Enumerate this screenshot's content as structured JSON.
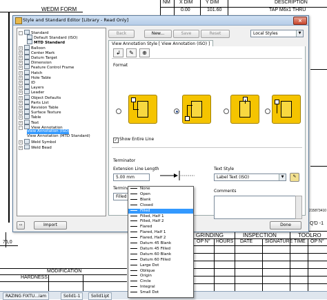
{
  "window": {
    "title": "Style and Standard Editor [Library - Read Only]",
    "close_glyph": "×"
  },
  "background": {
    "form_title": "WEDM FORM",
    "table_headers": [
      "NM",
      "X DIM",
      "Y DIM"
    ],
    "table_values": [
      "0.00",
      "101.60"
    ],
    "description_label": "DESCRIPTION",
    "tap_label": "TAP M6x1 THRU",
    "dim_75": "75,0",
    "part_no": "215873410",
    "qty_label": "Q'D -1",
    "grinding_label": "GRINDING",
    "inspection_label": "INSPECTION",
    "toolroom_label": "TOOLRO",
    "op_no": "OP N°",
    "hours": "HOURS",
    "date1": "DATE",
    "signature": "SIGNATURE",
    "time": "TIME",
    "op_no2": "OP N°",
    "modification": "MODIFICATION",
    "hardness": "HARDNESS",
    "tabs": [
      "RAZING FIXTU...iam",
      "Solid1-1",
      "Solid1ipt"
    ]
  },
  "toolbar": {
    "back": "Back",
    "new": "New...",
    "save": "Save",
    "reset": "Reset",
    "filter": "Local Styles"
  },
  "tree": [
    {
      "label": "Standard",
      "indent": 0,
      "bold": false,
      "expander": "-",
      "icon": "folder-icon"
    },
    {
      "label": "Default Standard (ISO)",
      "indent": 1,
      "bold": false,
      "expander": "",
      "icon": "standard-icon"
    },
    {
      "label": "MTD Standard",
      "indent": 1,
      "bold": true,
      "expander": "",
      "icon": "standard-icon"
    },
    {
      "label": "Balloon",
      "indent": 0,
      "bold": false,
      "expander": "+",
      "icon": "balloon-icon"
    },
    {
      "label": "Center Mark",
      "indent": 0,
      "bold": false,
      "expander": "+",
      "icon": "center-mark-icon"
    },
    {
      "label": "Datum Target",
      "indent": 0,
      "bold": false,
      "expander": "+",
      "icon": "datum-target-icon"
    },
    {
      "label": "Dimension",
      "indent": 0,
      "bold": false,
      "expander": "+",
      "icon": "dimension-icon"
    },
    {
      "label": "Feature Control Frame",
      "indent": 0,
      "bold": false,
      "expander": "+",
      "icon": "fcf-icon"
    },
    {
      "label": "Hatch",
      "indent": 0,
      "bold": false,
      "expander": "+",
      "icon": "hatch-icon"
    },
    {
      "label": "Hole Table",
      "indent": 0,
      "bold": false,
      "expander": "+",
      "icon": "hole-table-icon"
    },
    {
      "label": "ID",
      "indent": 0,
      "bold": false,
      "expander": "+",
      "icon": "id-icon"
    },
    {
      "label": "Layers",
      "indent": 0,
      "bold": false,
      "expander": "+",
      "icon": "layers-icon"
    },
    {
      "label": "Leader",
      "indent": 0,
      "bold": false,
      "expander": "+",
      "icon": "leader-icon"
    },
    {
      "label": "Object Defaults",
      "indent": 0,
      "bold": false,
      "expander": "+",
      "icon": "object-defaults-icon"
    },
    {
      "label": "Parts List",
      "indent": 0,
      "bold": false,
      "expander": "+",
      "icon": "parts-list-icon"
    },
    {
      "label": "Revision Table",
      "indent": 0,
      "bold": false,
      "expander": "+",
      "icon": "revision-table-icon"
    },
    {
      "label": "Surface Texture",
      "indent": 0,
      "bold": false,
      "expander": "+",
      "icon": "surface-texture-icon"
    },
    {
      "label": "Table",
      "indent": 0,
      "bold": false,
      "expander": "+",
      "icon": "table-icon"
    },
    {
      "label": "Text",
      "indent": 0,
      "bold": false,
      "expander": "+",
      "icon": "text-icon"
    },
    {
      "label": "View Annotation",
      "indent": 0,
      "bold": false,
      "expander": "-",
      "icon": "view-annotation-icon"
    },
    {
      "label": "View Annotation (ISO)",
      "indent": 1,
      "bold": false,
      "expander": "",
      "icon": "",
      "selected": true
    },
    {
      "label": "View Annotation (MTD Standard)",
      "indent": 1,
      "bold": false,
      "expander": "",
      "icon": ""
    },
    {
      "label": "Weld Symbol",
      "indent": 0,
      "bold": false,
      "expander": "+",
      "icon": "weld-symbol-icon"
    },
    {
      "label": "Weld Bead",
      "indent": 0,
      "bold": false,
      "expander": "+",
      "icon": "weld-bead-icon"
    }
  ],
  "tab": {
    "label": "View Annotation Style [ View Annotation (ISO) ]"
  },
  "format": {
    "label": "Format",
    "show_entire_line": "Show Entire Line",
    "show_entire_line_checked": true,
    "selected_index": 1
  },
  "terminator": {
    "label": "Terminator",
    "extension_label": "Extension Line Length",
    "extension_value": "5.00 mm",
    "terminator_label": "Terminator",
    "selected": "Filled",
    "options": [
      "None",
      "Open",
      "Blank",
      "Closed",
      "Filled",
      "Filled, Half 1",
      "Filled, Half 2",
      "Flared",
      "Flared, Half 1",
      "Flared, Half 2",
      "Datum 45 Blank",
      "Datum 45 Filled",
      "Datum 60 Blank",
      "Datum 60 Filled",
      "Large Dot",
      "Oblique",
      "Origin",
      "Circle",
      "Integral",
      "Small Dot"
    ]
  },
  "text_style": {
    "label": "Text Style",
    "value": "Label Text (ISO)",
    "comments_label": "Comments"
  },
  "footer": {
    "import": "Import",
    "done": "Done"
  },
  "colors": {
    "accent": "#3399ff",
    "format_yellow": "#f5c400",
    "title_bar": "#b6cde8"
  }
}
